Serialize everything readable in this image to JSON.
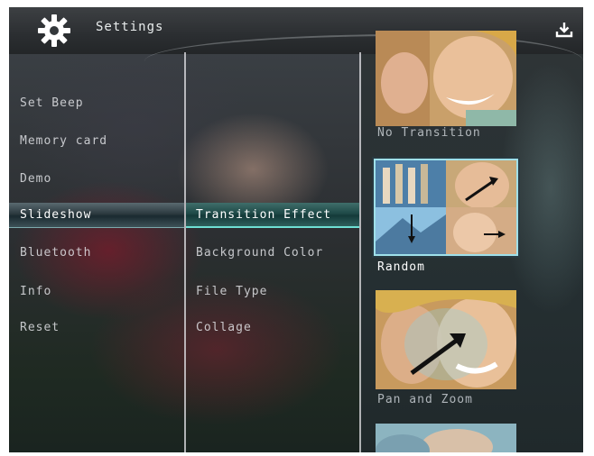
{
  "header": {
    "title": "Settings",
    "settings_icon": "gear-icon",
    "action_icon": "download-icon"
  },
  "menu": {
    "items": [
      {
        "label": "Set Beep"
      },
      {
        "label": "Memory card"
      },
      {
        "label": "Demo"
      },
      {
        "label": "Slideshow",
        "selected": true
      },
      {
        "label": "Bluetooth"
      },
      {
        "label": "Info"
      },
      {
        "label": "Reset"
      }
    ]
  },
  "submenu": {
    "items": [
      {
        "label": "Transition Effect",
        "selected": true
      },
      {
        "label": "Background Color"
      },
      {
        "label": "File Type"
      },
      {
        "label": "Collage"
      }
    ]
  },
  "options": {
    "items": [
      {
        "label": "No Transition"
      },
      {
        "label": "Random",
        "selected": true
      },
      {
        "label": "Pan and Zoom"
      },
      {
        "label": ""
      }
    ]
  },
  "colors": {
    "selection_accent": "#6ee0d4",
    "thumbnail_border": "#9fe0ea"
  }
}
